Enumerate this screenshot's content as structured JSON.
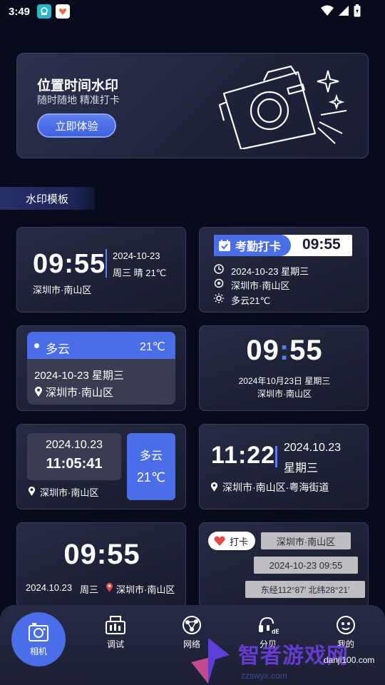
{
  "status_bar": {
    "time": "3:49"
  },
  "banner": {
    "title": "位置时间水印",
    "subtitle": "随时随地 精准打卡",
    "button_label": "立即体验"
  },
  "section": {
    "title": "水印模板"
  },
  "templates": {
    "t1": {
      "time": "09:55",
      "date": "2024-10-23",
      "weekday_weather": "周三  晴  21℃",
      "location": "深圳市·南山区"
    },
    "t2": {
      "badge": "考勤打卡",
      "time": "09:55",
      "date_line": "2024-10-23   星期三",
      "location": "深圳市·南山区",
      "weather": "多云21℃"
    },
    "t3": {
      "weather": "多云",
      "temp": "21℃",
      "date_line": "2024-10-23   星期三",
      "location": "深圳市·南山区"
    },
    "t4": {
      "time_h": "09",
      "time_m": "55",
      "date_line": "2024年10月23日  星期三",
      "location": "深圳市·南山区"
    },
    "t5": {
      "date": "2024.10.23",
      "time": "11:05:41",
      "weather": "多云",
      "temp": "21℃",
      "location": "深圳市·南山区"
    },
    "t6": {
      "time": "11:22",
      "date": "2024.10.23",
      "weekday": "星期三",
      "location": "深圳市·南山区·粤海街道"
    },
    "t7": {
      "time": "09:55",
      "date": "2024.10.23",
      "weekday": "周三",
      "location": "深圳市·南山区"
    },
    "t8": {
      "badge": "打卡",
      "location": "深圳市·南山区",
      "datetime": "2024-10-23   09:55",
      "coords": "东经112°87′  北纬28°21′"
    }
  },
  "bottom_nav": {
    "items": [
      {
        "label": "相机",
        "icon": "camera-icon"
      },
      {
        "label": "调试",
        "icon": "cash-register-icon"
      },
      {
        "label": "网络",
        "icon": "network-icon"
      },
      {
        "label": "分贝",
        "icon": "decibel-icon"
      },
      {
        "label": "我的",
        "icon": "face-icon"
      }
    ]
  },
  "watermark_overlay": {
    "text": "智者游戏网",
    "url": "zzswyx.com",
    "url2": "danji100.com"
  }
}
